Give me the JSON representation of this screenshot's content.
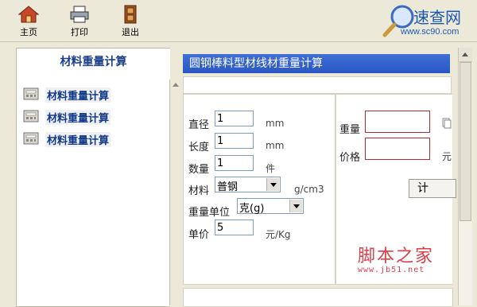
{
  "toolbar": {
    "home_label": "主页",
    "print_label": "打印",
    "exit_label": "退出"
  },
  "logo": {
    "brand": "速查网",
    "url": "www.sc90.com"
  },
  "sidebar": {
    "title": "材料重量计算",
    "items": [
      {
        "label": "材料重量计算"
      },
      {
        "label": "材料重量计算"
      },
      {
        "label": "材料重量计算"
      }
    ]
  },
  "main": {
    "title": "圆钢棒料型材线材重量计算",
    "fields": {
      "diameter": {
        "label": "直径",
        "value": "1",
        "unit": "mm"
      },
      "length": {
        "label": "长度",
        "value": "1",
        "unit": "mm"
      },
      "quantity": {
        "label": "数量",
        "value": "1",
        "unit": "件"
      },
      "material": {
        "label": "材料",
        "value": "普钢",
        "unit": "g/cm3"
      },
      "weight_unit": {
        "label": "重量单位",
        "value": "克(g)"
      },
      "unit_price": {
        "label": "单价",
        "value": "5",
        "unit": "元/Kg"
      }
    },
    "outputs": {
      "weight": {
        "label": "重量",
        "value": ""
      },
      "price": {
        "label": "价格",
        "value": "",
        "unit": "元"
      }
    },
    "calc_button": "计 算"
  },
  "watermark": {
    "cn": "脚本之家",
    "en": "www.jb51.net"
  }
}
